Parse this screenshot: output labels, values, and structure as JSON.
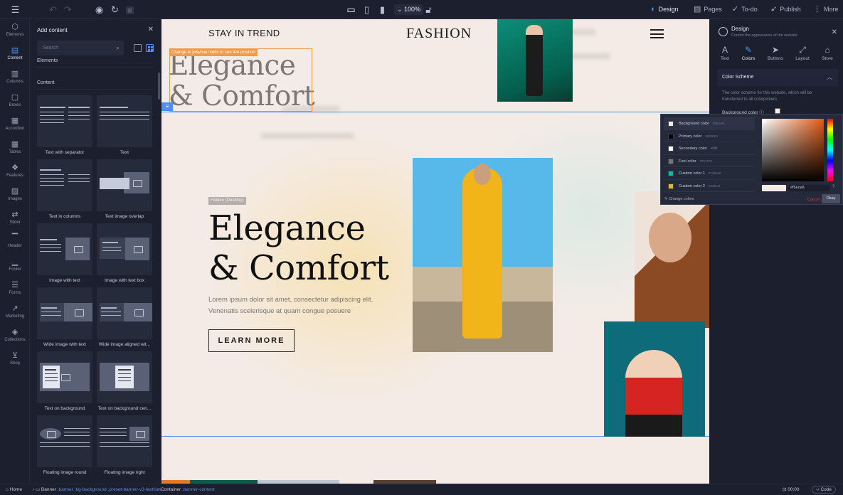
{
  "topbar": {
    "zoom": "100%",
    "design_label": "Design",
    "pages_label": "Pages",
    "todo_label": "To-do",
    "publish_label": "Publish",
    "more_label": "More"
  },
  "rail": {
    "items": [
      {
        "label": "Elements",
        "icon": "cube-icon"
      },
      {
        "label": "Content",
        "icon": "document-icon"
      },
      {
        "label": "Columns",
        "icon": "columns-icon"
      },
      {
        "label": "Boxes",
        "icon": "box-icon"
      },
      {
        "label": "Accordion",
        "icon": "accordion-icon"
      },
      {
        "label": "Tables",
        "icon": "table-icon"
      },
      {
        "label": "Features",
        "icon": "features-icon"
      },
      {
        "label": "Images",
        "icon": "image-icon"
      },
      {
        "label": "Slider",
        "icon": "slider-icon"
      },
      {
        "label": "Header",
        "icon": "header-icon"
      },
      {
        "label": "Footer",
        "icon": "footer-icon"
      },
      {
        "label": "Forms",
        "icon": "form-icon"
      },
      {
        "label": "Marketing",
        "icon": "chart-icon"
      },
      {
        "label": "Collections",
        "icon": "layers-icon"
      },
      {
        "label": "Shop",
        "icon": "cart-icon"
      }
    ]
  },
  "panel": {
    "title": "Add content",
    "search_placeholder": "Search",
    "elements_label": "Elements",
    "content_label": "Content",
    "cards": [
      {
        "label": "Text with separator"
      },
      {
        "label": "Text"
      },
      {
        "label": "Text in columns"
      },
      {
        "label": "Text image overlap"
      },
      {
        "label": "Image with text"
      },
      {
        "label": "Image with text box"
      },
      {
        "label": "Wide image with text"
      },
      {
        "label": "Wide image aligned wit..."
      },
      {
        "label": "Text on background"
      },
      {
        "label": "Text on background cen..."
      },
      {
        "label": "Floating image round"
      },
      {
        "label": "Floating image right"
      }
    ]
  },
  "site": {
    "nav_text": "STAY IN TREND",
    "brand": "FASHION",
    "preview_hint": "Change to preview mode to see live position",
    "ghost_title_1": "Elegance",
    "ghost_title_2": "& Comfort",
    "hidden_badge": "Hidden (Desktop)",
    "hero_title_1": "Elegance",
    "hero_title_2": "& Comfort",
    "hero_text_1": "Lorem ipsum dolor sit amet, consectetur adipiscing elit.",
    "hero_text_2": "Venenatis scelerisque at quam congue posuere",
    "button": "LEARN MORE"
  },
  "design": {
    "title": "Design",
    "subtitle": "Control the appearance of the website",
    "tabs": [
      {
        "label": "Text",
        "icon": "text-icon"
      },
      {
        "label": "Colors",
        "icon": "brush-icon"
      },
      {
        "label": "Buttons",
        "icon": "cursor-icon"
      },
      {
        "label": "Layout",
        "icon": "resize-icon"
      },
      {
        "label": "Store",
        "icon": "store-icon"
      }
    ],
    "section": "Color Scheme",
    "desc": "The color scheme for this website, which will be transferred to all colorpickers.",
    "bg_label": "Background color"
  },
  "picker": {
    "swatches": [
      {
        "name": "Background color",
        "hex": "#f5ece8",
        "color": "#f5ece8"
      },
      {
        "name": "Primary color",
        "hex": "#000000",
        "color": "#000000"
      },
      {
        "name": "Secondary color",
        "hex": "#ffffff",
        "color": "#ffffff"
      },
      {
        "name": "Font color",
        "hex": "#757575",
        "color": "#757575"
      },
      {
        "name": "Custom color 1",
        "hex": "#10b5a6",
        "color": "#10b5a6"
      },
      {
        "name": "Custom color 2",
        "hex": "#edb21f",
        "color": "#edb21f"
      }
    ],
    "change_colors": "Change colors",
    "hex_value": "#f5ece8",
    "cancel": "Cancel",
    "okay": "Okay"
  },
  "status": {
    "home": "Home",
    "banner": "Banner",
    "banner_classes": ".banner .bg-background .preset-banner-v3-fashion",
    "container": "Container",
    "container_classes": ".banner-content",
    "time": "00:00",
    "code": "Code"
  },
  "colors": {
    "accent": "#4f8ef7",
    "selection": "#f19a48",
    "canvas_bg": "#f4ebe6"
  }
}
